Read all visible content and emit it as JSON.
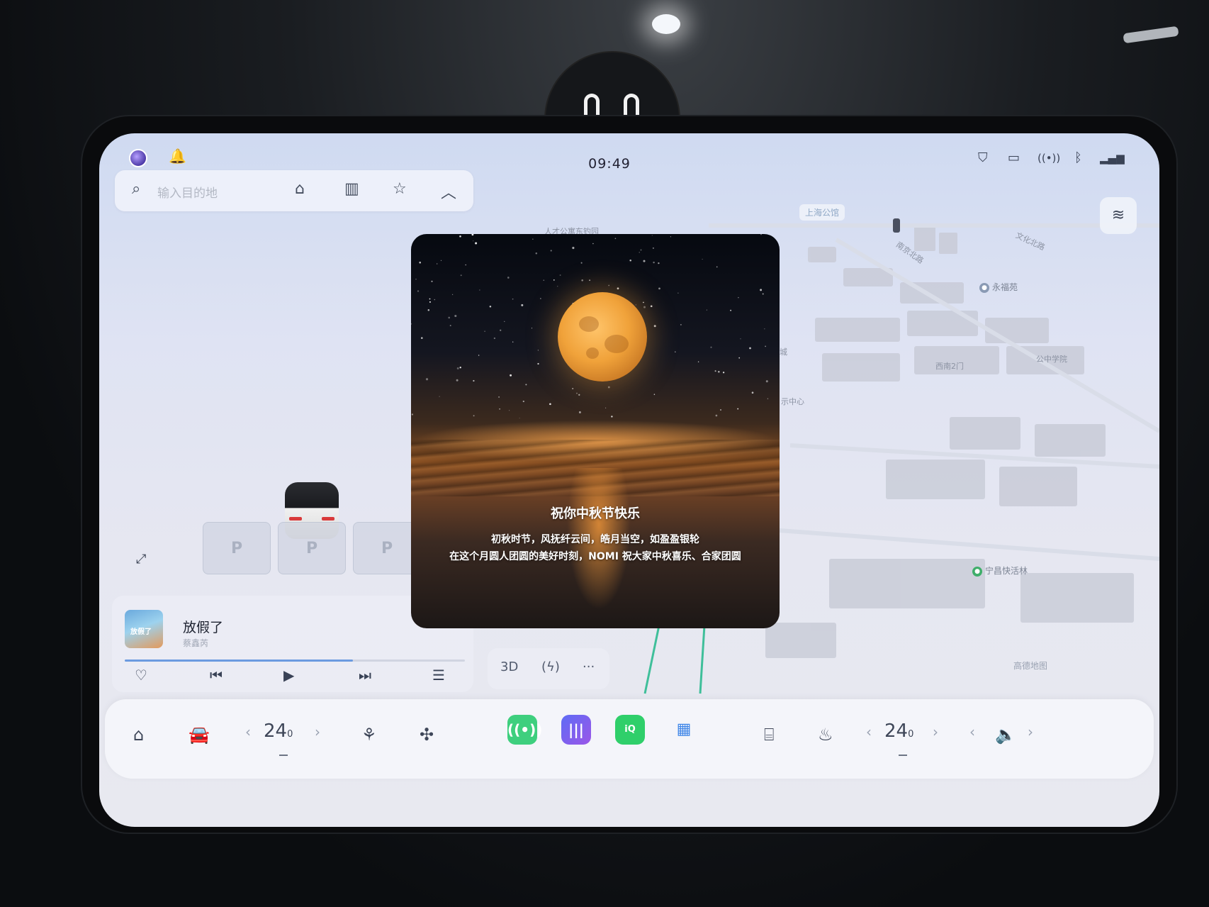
{
  "status_bar": {
    "time": "09:49"
  },
  "search": {
    "placeholder": "输入目的地"
  },
  "map": {
    "labels": [
      "人才公寓东钓园",
      "上海公馆",
      "南京北路",
      "文化北路",
      "永福苑",
      "宁昌快活林",
      "西南2门",
      "城",
      "示中心",
      "公中学院"
    ],
    "poi_name": "宁昌快活林",
    "brand": "高德地图"
  },
  "popup": {
    "title": "祝你中秋节快乐",
    "line1": "初秋时节，风抚纤云间，皓月当空，如盈盈银轮",
    "line2": "在这个月圆人团圆的美好时刻，NOMI 祝大家中秋喜乐、合家团圆"
  },
  "parking": {
    "slot_label": "P"
  },
  "music": {
    "song": "放假了",
    "artist": "蔡鑫芮",
    "progress": 0.67,
    "cover_text": "放假了"
  },
  "quick_actions": {
    "view_mode": "3D"
  },
  "dock": {
    "driver_temp": "24",
    "driver_temp_unit": "0",
    "passenger_temp": "24",
    "passenger_temp_unit": "0"
  },
  "colors": {
    "accent": "#6b9be0",
    "radio_app": "#3ecf7e",
    "voice_app": "#6a5cf0",
    "iqiyi_app": "#2fcf6a"
  }
}
